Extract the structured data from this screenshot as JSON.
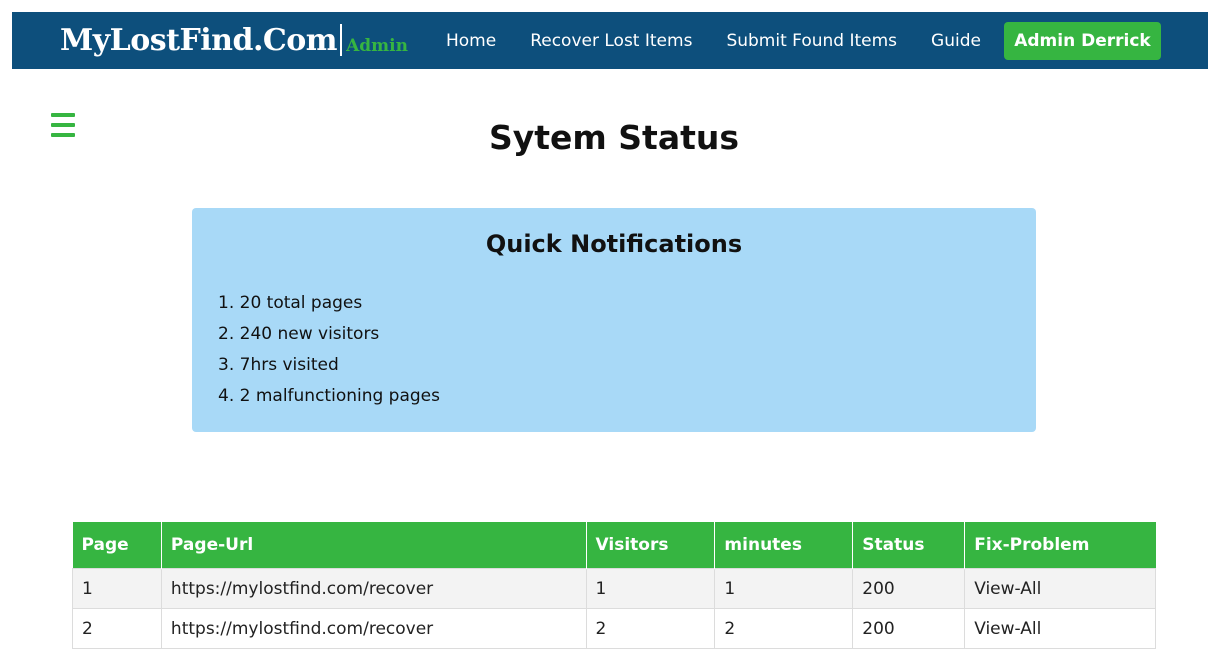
{
  "navbar": {
    "brand_name": "MyLostFind.Com",
    "brand_admin": "Admin",
    "links": [
      "Home",
      "Recover Lost Items",
      "Submit Found Items",
      "Guide"
    ],
    "admin_button": "Admin Derrick"
  },
  "page": {
    "title": "Sytem Status"
  },
  "notifications": {
    "title": "Quick Notifications",
    "items": [
      "1. 20 total pages",
      "2. 240 new visitors",
      "3. 7hrs visited",
      "4. 2 malfunctioning pages"
    ]
  },
  "table": {
    "headers": [
      "Page",
      "Page-Url",
      "Visitors",
      "minutes",
      "Status",
      "Fix-Problem"
    ],
    "rows": [
      [
        "1",
        "https://mylostfind.com/recover",
        "1",
        "1",
        "200",
        "View-All"
      ],
      [
        "2",
        "https://mylostfind.com/recover",
        "2",
        "2",
        "200",
        "View-All"
      ]
    ]
  },
  "colors": {
    "navbar": "#0d4f7c",
    "accent": "#36b541",
    "notification_bg": "#a8d9f7"
  },
  "icons": {
    "menu": "hamburger-menu-icon"
  }
}
